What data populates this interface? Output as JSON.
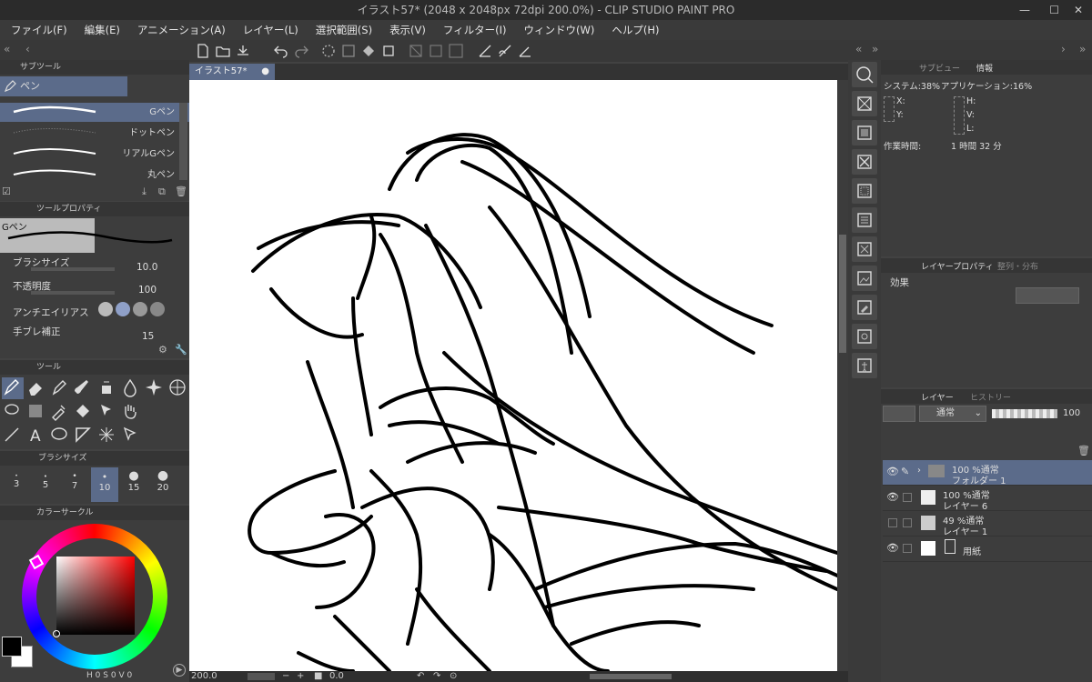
{
  "window": {
    "title": "イラスト57* (2048 x 2048px 72dpi 200.0%)  - CLIP STUDIO PAINT PRO"
  },
  "menu": [
    "ファイル(F)",
    "編集(E)",
    "アニメーション(A)",
    "レイヤー(L)",
    "選択範囲(S)",
    "表示(V)",
    "フィルター(I)",
    "ウィンドウ(W)",
    "ヘルプ(H)"
  ],
  "document": {
    "tab_label": "イラスト57*"
  },
  "subtool": {
    "header": "サブツール",
    "group": "ペン",
    "brushes": [
      "Gペン",
      "ドットペン",
      "リアルGペン",
      "丸ペン"
    ]
  },
  "tool_property": {
    "header": "ツールプロパティ",
    "current": "Gペン",
    "brush_size_label": "ブラシサイズ",
    "brush_size_value": "10.0",
    "opacity_label": "不透明度",
    "opacity_value": "100",
    "antialias_label": "アンチエイリアス",
    "stabilization_label": "手ブレ補正",
    "stabilization_value": "15"
  },
  "tool_panel": {
    "header": "ツール"
  },
  "brush_size_panel": {
    "header": "ブラシサイズ",
    "sizes": [
      "3",
      "5",
      "7",
      "10",
      "15",
      "20"
    ]
  },
  "color_panel": {
    "header": "カラーサークル",
    "readout": {
      "h_label": "H",
      "h_value": "0",
      "s_label": "S",
      "s_value": "0",
      "v_label": "V",
      "v_value": "0"
    },
    "colors": {
      "main": "#000000",
      "sub": "#ffffff"
    }
  },
  "status": {
    "zoom": "200.0",
    "angle": "0.0"
  },
  "info_panel": {
    "tab_subview": "サブビュー",
    "tab_info": "情報",
    "system": "システム:38%",
    "application": "アプリケーション:16%",
    "x_label": "X:",
    "y_label": "Y:",
    "h_label": "H:",
    "v_label": "V:",
    "l_label": "L:",
    "work_time_label": "作業時間:",
    "work_time_value": "1 時間 32 分"
  },
  "layer_property": {
    "tab": "レイヤープロパティ",
    "tab2": "整列・分布",
    "effect_label": "効果"
  },
  "layer_panel": {
    "tab_layer": "レイヤー",
    "tab_history": "ヒストリー",
    "blend_mode": "通常",
    "opacity": "100",
    "layers": [
      {
        "meta": "100 %通常",
        "name": "フォルダー 1",
        "visible": true,
        "selected": true
      },
      {
        "meta": "100 %通常",
        "name": "レイヤー 6",
        "visible": true,
        "selected": false
      },
      {
        "meta": "49 %通常",
        "name": "レイヤー 1",
        "visible": false,
        "selected": false
      },
      {
        "meta": "",
        "name": "用紙",
        "visible": true,
        "selected": false
      }
    ]
  },
  "theme": {
    "accent": "#5b6b8a",
    "panel_bg": "#3d3d3d",
    "canvas": "#ffffff"
  }
}
